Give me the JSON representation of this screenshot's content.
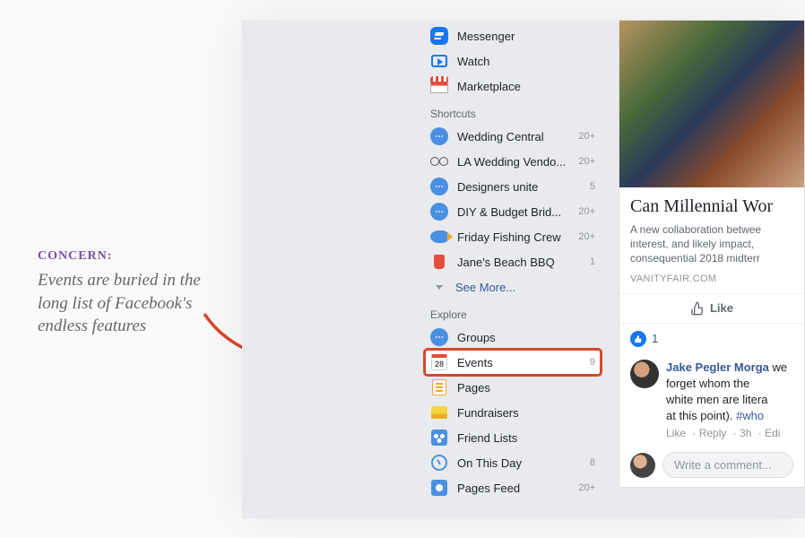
{
  "annotation": {
    "heading": "CONCERN:",
    "body": "Events are buried in the long list of Facebook's endless features"
  },
  "sidebar": {
    "top_items": [
      {
        "label": "Messenger",
        "icon": "messenger"
      },
      {
        "label": "Watch",
        "icon": "watch"
      },
      {
        "label": "Marketplace",
        "icon": "marketplace"
      }
    ],
    "sections": [
      {
        "header": "Shortcuts",
        "items": [
          {
            "label": "Wedding Central",
            "count": "20+",
            "icon": "group"
          },
          {
            "label": "LA Wedding Vendo...",
            "count": "20+",
            "icon": "glasses"
          },
          {
            "label": "Designers unite",
            "count": "5",
            "icon": "group"
          },
          {
            "label": "DIY & Budget Brid...",
            "count": "20+",
            "icon": "group"
          },
          {
            "label": "Friday Fishing Crew",
            "count": "20+",
            "icon": "fish"
          },
          {
            "label": "Jane's Beach BBQ",
            "count": "1",
            "icon": "cup"
          }
        ],
        "see_more": "See More..."
      },
      {
        "header": "Explore",
        "items": [
          {
            "label": "Groups",
            "count": "",
            "icon": "group"
          },
          {
            "label": "Events",
            "count": "9",
            "icon": "events",
            "highlighted": true
          },
          {
            "label": "Pages",
            "count": "",
            "icon": "pages"
          },
          {
            "label": "Fundraisers",
            "count": "",
            "icon": "fund"
          },
          {
            "label": "Friend Lists",
            "count": "",
            "icon": "friends"
          },
          {
            "label": "On This Day",
            "count": "8",
            "icon": "clock"
          },
          {
            "label": "Pages Feed",
            "count": "20+",
            "icon": "feed"
          }
        ]
      }
    ]
  },
  "feed": {
    "article": {
      "title": "Can Millennial Wor",
      "description": "A new collaboration betwee\ninterest, and likely impact, \nconsequential 2018 midterr",
      "source": "VANITYFAIR.COM",
      "like_label": "Like",
      "reaction_count": "1"
    },
    "comment": {
      "author": "Jake Pegler Morga",
      "text_line1": "we forget whom the",
      "text_line2": "white men are litera",
      "text_line3": "at this point).",
      "hashtag": "#who",
      "meta_like": "Like",
      "meta_reply": "Reply",
      "meta_time": "3h",
      "meta_edited": "Edi"
    },
    "comment_input_placeholder": "Write a comment..."
  },
  "icons": {
    "events_date": "28"
  }
}
